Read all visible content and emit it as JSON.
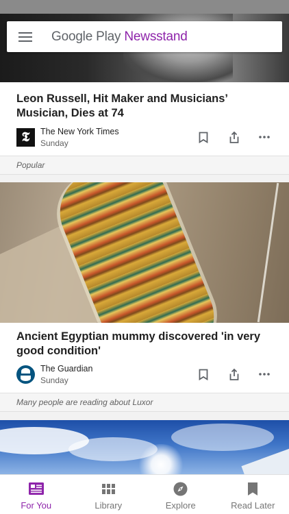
{
  "app": {
    "brand_prefix": "Google Play",
    "brand_suffix": "Newsstand",
    "accent_color": "#8e24aa"
  },
  "articles": [
    {
      "headline": "Leon Russell, Hit Maker and Musicians’ Musician, Dies at 74",
      "source": "The New York Times",
      "date": "Sunday",
      "logo": "𝕿",
      "footer": "Popular"
    },
    {
      "headline": "Ancient Egyptian mummy discovered 'in very good condition'",
      "source": "The Guardian",
      "date": "Sunday",
      "footer": "Many people are reading about Luxor"
    }
  ],
  "bottom_nav": {
    "items": [
      {
        "label": "For You",
        "icon": "for-you-icon",
        "active": true
      },
      {
        "label": "Library",
        "icon": "library-grid-icon",
        "active": false
      },
      {
        "label": "Explore",
        "icon": "compass-icon",
        "active": false
      },
      {
        "label": "Read Later",
        "icon": "bookmark-icon",
        "active": false
      }
    ]
  }
}
